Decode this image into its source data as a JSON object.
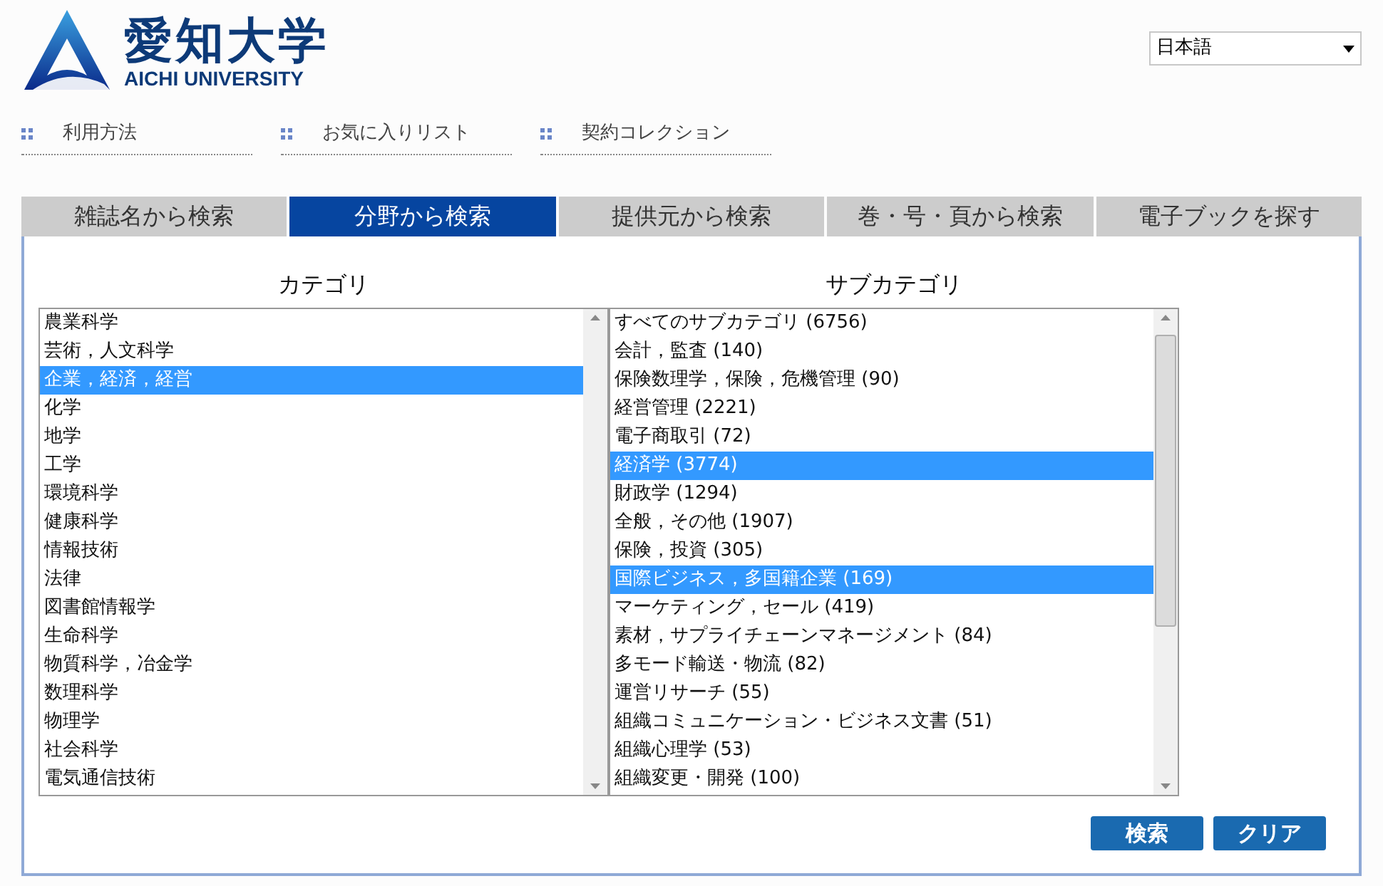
{
  "logo": {
    "title": "愛知大学",
    "subtitle": "AICHI UNIVERSITY"
  },
  "language": {
    "value": "日本語"
  },
  "nav": [
    {
      "label": "利用方法"
    },
    {
      "label": "お気に入りリスト"
    },
    {
      "label": "契約コレクション"
    }
  ],
  "tabs": [
    {
      "label": "雑誌名から検索",
      "selected": false
    },
    {
      "label": "分野から検索",
      "selected": true
    },
    {
      "label": "提供元から検索",
      "selected": false
    },
    {
      "label": "巻・号・頁から検索",
      "selected": false
    },
    {
      "label": "電子ブックを探す",
      "selected": false
    }
  ],
  "category": {
    "heading": "カテゴリ",
    "items": [
      {
        "label": "農業科学",
        "selected": false
      },
      {
        "label": "芸術，人文科学",
        "selected": false
      },
      {
        "label": "企業，経済，経営",
        "selected": true
      },
      {
        "label": "化学",
        "selected": false
      },
      {
        "label": "地学",
        "selected": false
      },
      {
        "label": "工学",
        "selected": false
      },
      {
        "label": "環境科学",
        "selected": false
      },
      {
        "label": "健康科学",
        "selected": false
      },
      {
        "label": "情報技術",
        "selected": false
      },
      {
        "label": "法律",
        "selected": false
      },
      {
        "label": "図書館情報学",
        "selected": false
      },
      {
        "label": "生命科学",
        "selected": false
      },
      {
        "label": "物質科学，冶金学",
        "selected": false
      },
      {
        "label": "数理科学",
        "selected": false
      },
      {
        "label": "物理学",
        "selected": false
      },
      {
        "label": "社会科学",
        "selected": false
      },
      {
        "label": "電気通信技術",
        "selected": false
      }
    ]
  },
  "subcategory": {
    "heading": "サブカテゴリ",
    "items": [
      {
        "label": "すべてのサブカテゴリ (6756)",
        "selected": false
      },
      {
        "label": "会計，監査 (140)",
        "selected": false
      },
      {
        "label": "保険数理学，保険，危機管理 (90)",
        "selected": false
      },
      {
        "label": "経営管理 (2221)",
        "selected": false
      },
      {
        "label": "電子商取引 (72)",
        "selected": false
      },
      {
        "label": "経済学 (3774)",
        "selected": true
      },
      {
        "label": "財政学 (1294)",
        "selected": false
      },
      {
        "label": "全般，その他 (1907)",
        "selected": false
      },
      {
        "label": "保険，投資 (305)",
        "selected": false
      },
      {
        "label": "国際ビジネス，多国籍企業 (169)",
        "selected": true
      },
      {
        "label": "マーケティング，セール (419)",
        "selected": false
      },
      {
        "label": "素材，サプライチェーンマネージメント (84)",
        "selected": false
      },
      {
        "label": "多モード輸送・物流 (82)",
        "selected": false
      },
      {
        "label": "運営リサーチ (55)",
        "selected": false
      },
      {
        "label": "組織コミュニケーション・ビジネス文書 (51)",
        "selected": false
      },
      {
        "label": "組織心理学 (53)",
        "selected": false
      },
      {
        "label": "組織変更・開発 (100)",
        "selected": false
      }
    ]
  },
  "buttons": [
    {
      "label": "検索"
    },
    {
      "label": "クリア"
    }
  ]
}
